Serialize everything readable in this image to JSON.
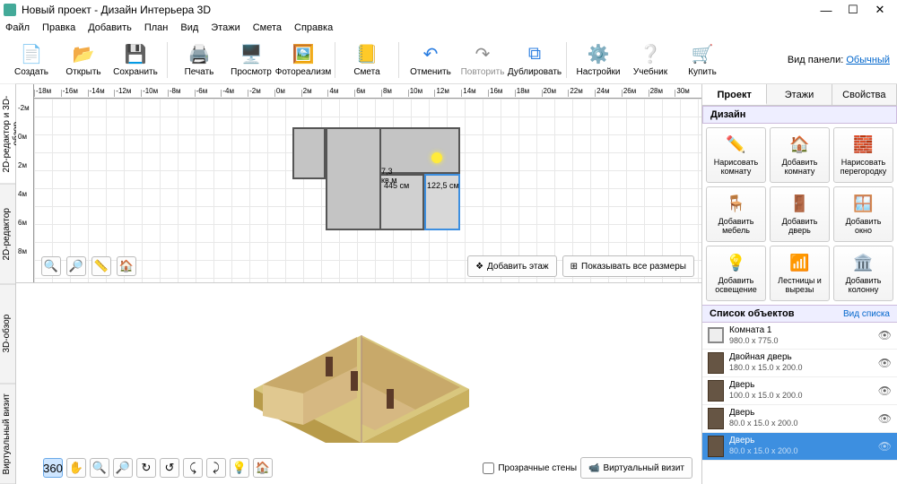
{
  "title": "Новый проект - Дизайн Интерьера 3D",
  "win": {
    "min": "—",
    "max": "☐",
    "close": "✕"
  },
  "menu": [
    "Файл",
    "Правка",
    "Добавить",
    "План",
    "Вид",
    "Этажи",
    "Смета",
    "Справка"
  ],
  "toolbar": {
    "create": "Создать",
    "open": "Открыть",
    "save": "Сохранить",
    "print": "Печать",
    "preview": "Просмотр",
    "photo": "Фотореализм",
    "budget": "Смета",
    "undo": "Отменить",
    "redo": "Повторить",
    "duplicate": "Дублировать",
    "settings": "Настройки",
    "tutorial": "Учебник",
    "buy": "Купить",
    "panel_label": "Вид панели:",
    "panel_link": "Обычный"
  },
  "ruler_h": [
    "-18м",
    "-16м",
    "-14м",
    "-12м",
    "-10м",
    "-8м",
    "-6м",
    "-4м",
    "-2м",
    "0м",
    "2м",
    "4м",
    "6м",
    "8м",
    "10м",
    "12м",
    "14м",
    "16м",
    "18м",
    "20м",
    "22м",
    "24м",
    "26м",
    "28м",
    "30м"
  ],
  "ruler_v": [
    "-2м",
    "0м",
    "2м",
    "4м",
    "6м",
    "8м"
  ],
  "plan_dims": {
    "w": "445 см",
    "d": "122,5 см",
    "room_lbl": "7,3 кв.м"
  },
  "plan_btns": {
    "add_floor": "Добавить этаж",
    "show_dims": "Показывать все размеры"
  },
  "preview_btns": {
    "transparent": "Прозрачные стены",
    "virtual": "Виртуальный визит"
  },
  "vtabs": [
    "2D-редактор и 3D-обзор",
    "2D-редактор",
    "3D-обзор",
    "Виртуальный визит"
  ],
  "rtabs": [
    "Проект",
    "Этажи",
    "Свойства"
  ],
  "design_hdr": "Дизайн",
  "design": [
    {
      "l1": "Нарисовать",
      "l2": "комнату",
      "ic": "✏️"
    },
    {
      "l1": "Добавить",
      "l2": "комнату",
      "ic": "🏠"
    },
    {
      "l1": "Нарисовать",
      "l2": "перегородку",
      "ic": "🧱"
    },
    {
      "l1": "Добавить",
      "l2": "мебель",
      "ic": "🪑"
    },
    {
      "l1": "Добавить",
      "l2": "дверь",
      "ic": "🚪"
    },
    {
      "l1": "Добавить",
      "l2": "окно",
      "ic": "🪟"
    },
    {
      "l1": "Добавить",
      "l2": "освещение",
      "ic": "💡"
    },
    {
      "l1": "Лестницы и",
      "l2": "вырезы",
      "ic": "📶"
    },
    {
      "l1": "Добавить",
      "l2": "колонну",
      "ic": "🏛️"
    }
  ],
  "objlist_hdr": "Список объектов",
  "objlist_link": "Вид списка",
  "objects": [
    {
      "name": "Комната 1",
      "dims": "980.0 x 775.0",
      "room": true,
      "sel": false
    },
    {
      "name": "Двойная дверь",
      "dims": "180.0 x 15.0 x 200.0",
      "sel": false
    },
    {
      "name": "Дверь",
      "dims": "100.0 x 15.0 x 200.0",
      "sel": false
    },
    {
      "name": "Дверь",
      "dims": "80.0 x 15.0 x 200.0",
      "sel": false
    },
    {
      "name": "Дверь",
      "dims": "80.0 x 15.0 x 200.0",
      "sel": true
    }
  ]
}
